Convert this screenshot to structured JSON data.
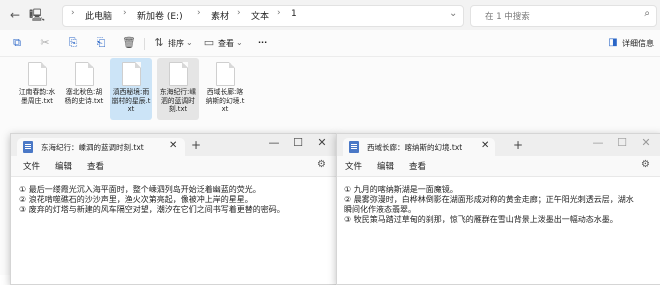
{
  "explorer": {
    "address": {
      "crumbs": [
        "此电脑",
        "新加卷 (E:)",
        "素材",
        "文本",
        "1"
      ],
      "separator": "›"
    },
    "search": {
      "placeholder": "在 1 中搜索"
    },
    "nav_icons": [
      "back-icon",
      "computer-icon"
    ],
    "commands": {
      "sort_label": "排序",
      "view_label": "查看",
      "more_label": "···",
      "details_label": "详细信息"
    },
    "files": [
      {
        "name": "江南春韵:水墨周庄.txt",
        "state": "normal"
      },
      {
        "name": "塞北秋色:胡杨的史诗.txt",
        "state": "normal"
      },
      {
        "name": "滇西秘境:雨崩村的星辰.txt",
        "state": "selected"
      },
      {
        "name": "东海纪行:嵊泗的蓝调时刻.txt",
        "state": "hover"
      },
      {
        "name": "西域长廊:喀纳斯的幻境.txt",
        "state": "normal"
      }
    ]
  },
  "notepad_left": {
    "tab_title": "东海纪行：嵊泗的蓝调时刻.txt",
    "menus": [
      "文件",
      "编辑",
      "查看"
    ],
    "lines": [
      "① 最后一缕霞光沉入海平面时，整个嵊泗列岛开始泛着幽蓝的荧光。",
      "② 浪花啃噬礁石的沙沙声里，渔火次第亮起，像被冲上岸的星星。",
      "③ 废弃的灯塔与新建的风车隔空对望，潮汐在它们之间书写着更替的密码。"
    ]
  },
  "notepad_right": {
    "tab_title": "西域长廊：喀纳斯的幻境.txt",
    "menus": [
      "文件",
      "编辑",
      "查看"
    ],
    "lines": [
      "① 九月的喀纳斯湖是一面魔镜。",
      "② 晨雾弥漫时，白桦林倒影在湖面形成对称的黄金走廊；正午阳光刺透云层，湖水",
      "瞬间化作液态翡翠。",
      "③ 牧民策马踏过草甸的刹那，惊飞的雁群在雪山背景上泼墨出一幅动态水墨。"
    ]
  },
  "window_controls": {
    "minimize": "—",
    "maximize": "☐",
    "close": "✕",
    "tab_close": "✕",
    "new_tab": "+"
  }
}
